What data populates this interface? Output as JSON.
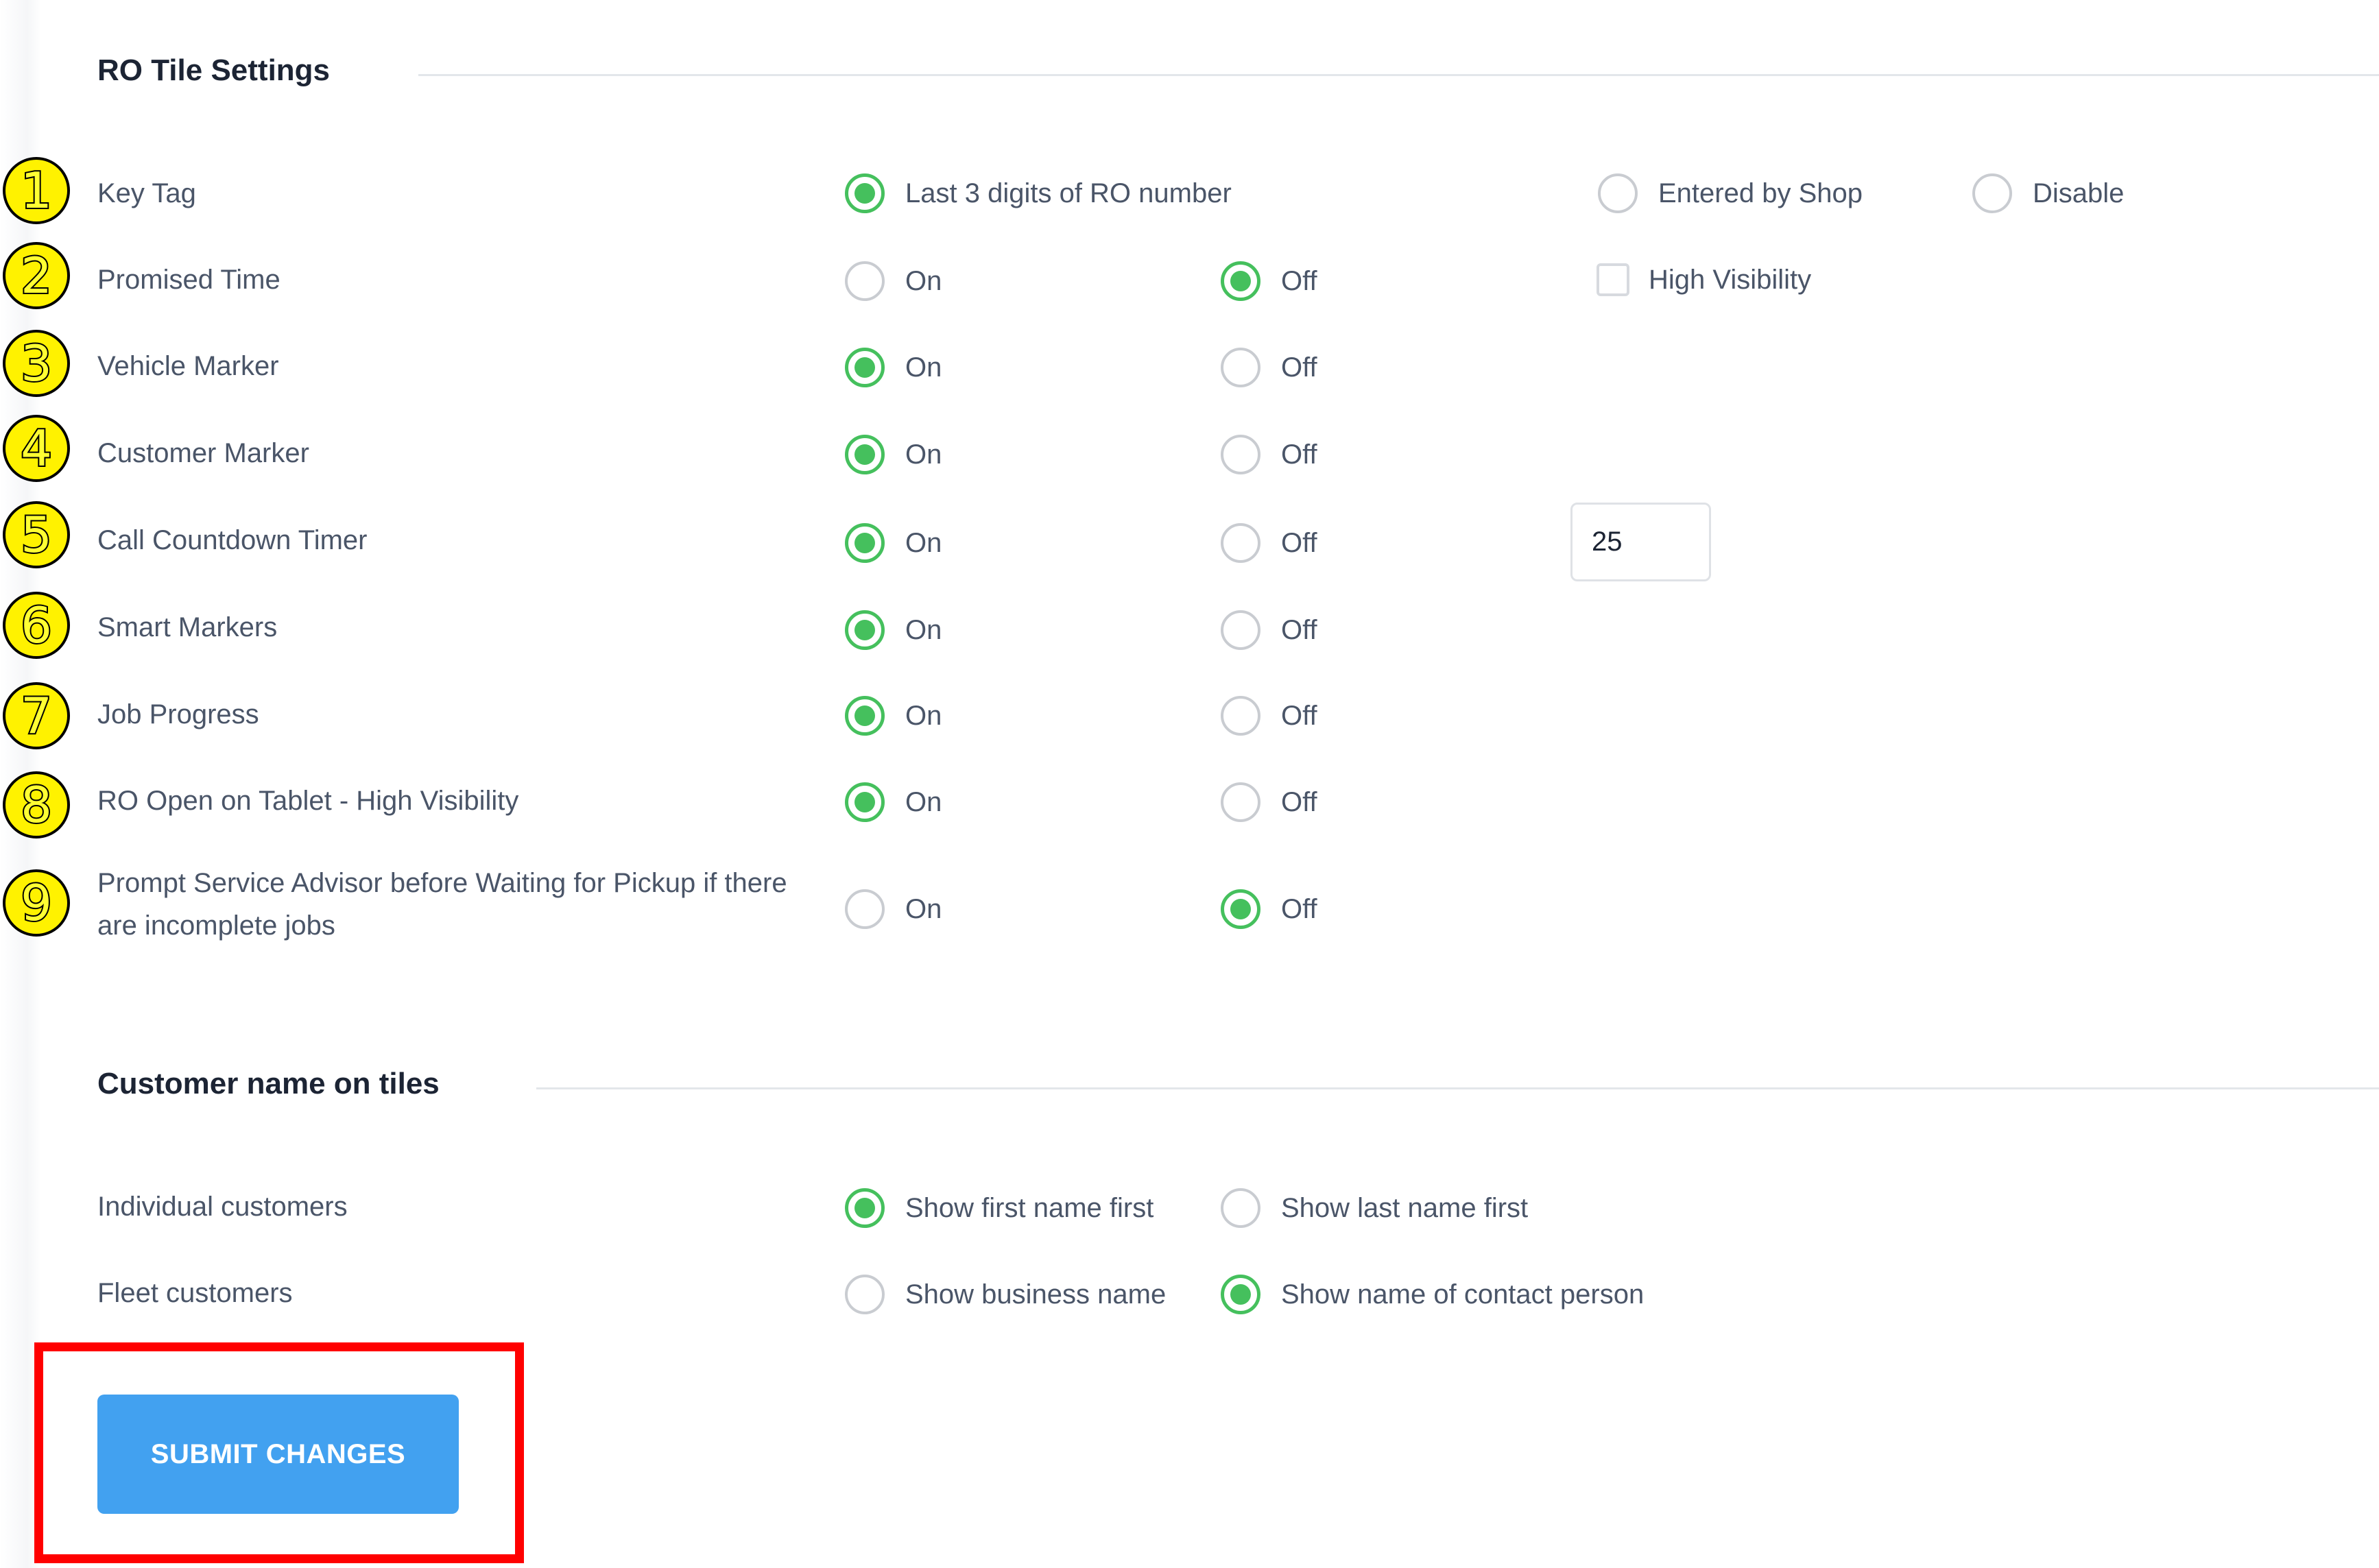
{
  "section1": {
    "title": "RO Tile Settings"
  },
  "settings": [
    {
      "badge": "1",
      "label": "Key Tag",
      "options": [
        {
          "label": "Last 3 digits of RO number",
          "checked": true
        },
        {
          "label": "Entered by Shop",
          "checked": false
        },
        {
          "label": "Disable",
          "checked": false
        }
      ]
    },
    {
      "badge": "2",
      "label": "Promised Time",
      "options": [
        {
          "label": "On",
          "checked": false
        },
        {
          "label": "Off",
          "checked": true
        }
      ],
      "checkbox": {
        "label": "High Visibility",
        "checked": false
      }
    },
    {
      "badge": "3",
      "label": "Vehicle Marker",
      "options": [
        {
          "label": "On",
          "checked": true
        },
        {
          "label": "Off",
          "checked": false
        }
      ]
    },
    {
      "badge": "4",
      "label": "Customer Marker",
      "options": [
        {
          "label": "On",
          "checked": true
        },
        {
          "label": "Off",
          "checked": false
        }
      ]
    },
    {
      "badge": "5",
      "label": "Call Countdown Timer",
      "options": [
        {
          "label": "On",
          "checked": true
        },
        {
          "label": "Off",
          "checked": false
        }
      ],
      "input_value": "25"
    },
    {
      "badge": "6",
      "label": "Smart Markers",
      "options": [
        {
          "label": "On",
          "checked": true
        },
        {
          "label": "Off",
          "checked": false
        }
      ]
    },
    {
      "badge": "7",
      "label": "Job Progress",
      "options": [
        {
          "label": "On",
          "checked": true
        },
        {
          "label": "Off",
          "checked": false
        }
      ]
    },
    {
      "badge": "8",
      "label": "RO Open on Tablet - High Visibility",
      "options": [
        {
          "label": "On",
          "checked": true
        },
        {
          "label": "Off",
          "checked": false
        }
      ]
    },
    {
      "badge": "9",
      "label": "Prompt Service Advisor before Waiting for Pickup if there are incomplete jobs",
      "options": [
        {
          "label": "On",
          "checked": false
        },
        {
          "label": "Off",
          "checked": true
        }
      ]
    }
  ],
  "section2": {
    "title": "Customer name on tiles"
  },
  "customer_name": [
    {
      "label": "Individual customers",
      "options": [
        {
          "label": "Show first name first",
          "checked": true
        },
        {
          "label": "Show last name first",
          "checked": false
        }
      ]
    },
    {
      "label": "Fleet customers",
      "options": [
        {
          "label": "Show business name",
          "checked": false
        },
        {
          "label": "Show name of contact person",
          "checked": true
        }
      ]
    }
  ],
  "submit": {
    "label": "SUBMIT CHANGES"
  },
  "colors": {
    "radio_checked": "#45c05d",
    "radio_unchecked": "#c9ccd1",
    "button": "#42a1f0",
    "highlight": "#ff0000",
    "badge": "#fff200"
  }
}
